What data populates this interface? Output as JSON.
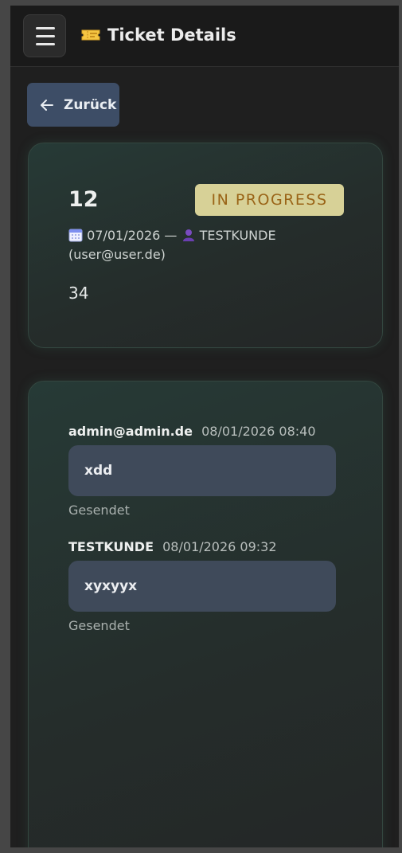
{
  "header": {
    "title": "Ticket Details",
    "menu_icon": "hamburger-menu-icon",
    "title_icon": "ticket-icon"
  },
  "back_button": {
    "label": "Zurück",
    "icon": "arrow-left-icon"
  },
  "ticket": {
    "id": "12",
    "status": "IN PROGRESS",
    "date_icon": "calendar-icon",
    "date": "07/01/2026",
    "separator": "—",
    "user_icon": "user-icon",
    "customer": "TESTKUNDE",
    "customer_email": "(user@user.de)",
    "description": "34"
  },
  "messages": [
    {
      "author": "admin@admin.de",
      "timestamp": "08/01/2026 08:40",
      "text": "xdd",
      "status": "Gesendet"
    },
    {
      "author": "TESTKUNDE",
      "timestamp": "08/01/2026 09:32",
      "text": "xyxyyx",
      "status": "Gesendet"
    }
  ],
  "colors": {
    "status_badge_bg": "#d7d197",
    "status_badge_text": "#9a6417",
    "back_button_bg": "#3d4d66",
    "bubble_bg": "#3f4a5a",
    "card_bg": "#263a36"
  }
}
